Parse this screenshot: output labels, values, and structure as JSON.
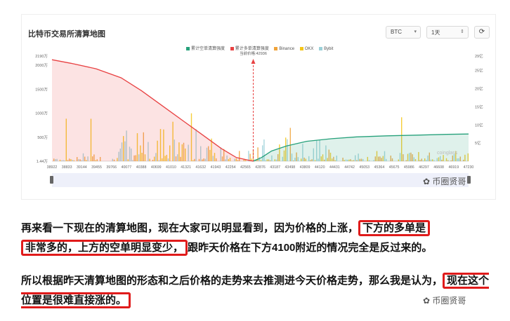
{
  "header": {
    "title": "比特币交易所清算地图",
    "coin_select": "BTC",
    "range_select": "1天"
  },
  "legend": [
    {
      "label": "累计空单清算强度",
      "color": "#26a17b"
    },
    {
      "label": "累计多单清算强度",
      "color": "#e84142"
    },
    {
      "label": "Binance",
      "color": "#f0a33a"
    },
    {
      "label": "OKX",
      "color": "#f5c518"
    },
    {
      "label": "Bybit",
      "color": "#9ad0d8"
    }
  ],
  "current_price_label": "当前价格:42936",
  "brand_watermark": "coinglass",
  "chart_data": {
    "type": "area",
    "x_ticks": [
      "38922",
      "38833",
      "39144",
      "39455",
      "39766",
      "40077",
      "40388",
      "40699",
      "41010",
      "41321",
      "41632",
      "41943",
      "42254",
      "42565",
      "42876",
      "43187",
      "43498",
      "43809",
      "44120",
      "44431",
      "44742",
      "45053",
      "45364",
      "45675",
      "45986",
      "46297",
      "46608",
      "46919",
      "47230"
    ],
    "y_left_ticks": [
      "1.44万",
      "500万",
      "1000万",
      "1500万",
      "2000万",
      "2190万"
    ],
    "y_left_range": [
      0,
      21900000
    ],
    "y_right_ticks": [
      "5亿",
      "10亿",
      "15亿",
      "20亿",
      "25亿",
      "29亿"
    ],
    "y_right_range": [
      0,
      2900000000
    ],
    "current_price": 42936,
    "series": [
      {
        "name": "累计多单清算强度",
        "x": [
          38922,
          39300,
          39800,
          40300,
          40700,
          41100,
          41500,
          41900,
          42300,
          42600,
          42936
        ],
        "values": [
          2.8,
          2.7,
          2.55,
          2.3,
          1.95,
          1.55,
          1.15,
          0.75,
          0.35,
          0.1,
          0
        ]
      },
      {
        "name": "累计空单清算强度",
        "x": [
          42936,
          43100,
          43300,
          43600,
          44000,
          44500,
          45000,
          45600,
          46200,
          46800,
          47230
        ],
        "values": [
          0,
          0.1,
          0.28,
          0.42,
          0.55,
          0.62,
          0.67,
          0.7,
          0.72,
          0.74,
          0.75
        ]
      }
    ]
  },
  "watermarks": [
    "币圈贤哥",
    "币圈贤哥"
  ],
  "article": {
    "p1_a": "再来看一下现在的清算地图，现在大家可以明显看到，因为价格的上涨，",
    "p1_hl1": "下方的多单是",
    "p1_hl2": "非常多的，上方的空单明显变少，",
    "p1_b": "跟昨天价格在下方4100附近的情况完全是反过来的。",
    "p2_a": "所以根据昨天清算地图的形态和之后价格的走势来去推测进今天价格走势，那么我是认为，",
    "p2_hl": "现在这个位置是很难直接涨的。"
  }
}
